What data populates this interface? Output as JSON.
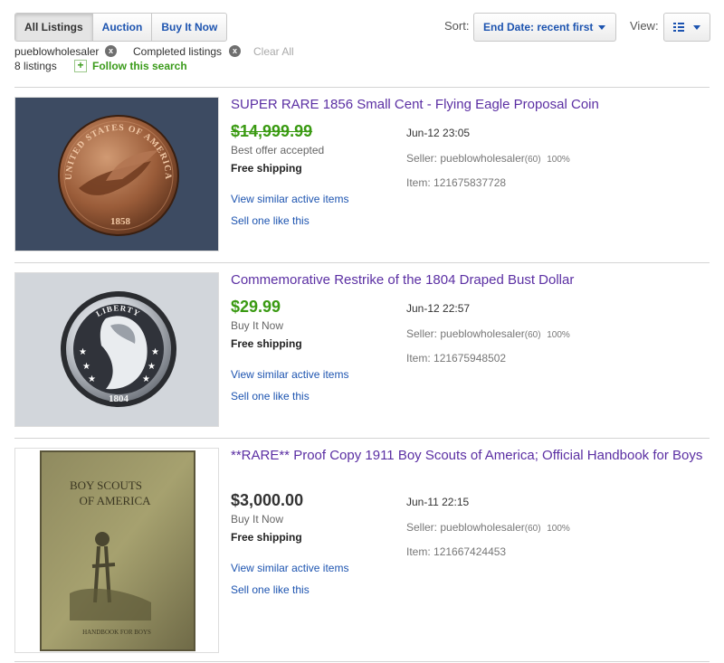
{
  "tabs": [
    "All Listings",
    "Auction",
    "Buy It Now"
  ],
  "sort": {
    "label": "Sort:",
    "value": "End Date: recent first"
  },
  "view": {
    "label": "View:"
  },
  "filters": [
    {
      "label": "pueblowholesaler",
      "remove_icon": "x"
    },
    {
      "label": "Completed listings",
      "remove_icon": "x"
    }
  ],
  "clear_all": "Clear All",
  "listing_count": "8 listings",
  "follow_label": "Follow this search",
  "listings": [
    {
      "title": "SUPER RARE 1856 Small Cent - Flying Eagle Proposal Coin",
      "price": "$14,999.99",
      "status": "Best offer accepted",
      "shipping": "Free shipping",
      "link_similar": "View similar active items",
      "link_sell": "Sell one like this",
      "date": "Jun-12 23:05",
      "seller_label": "Seller:",
      "seller_name": "pueblowholesaler",
      "seller_score": "(60)",
      "seller_pct": "100%",
      "item_label": "Item:",
      "item_number": "121675837728"
    },
    {
      "title": "Commemorative Restrike of the 1804 Draped Bust Dollar",
      "price": "$29.99",
      "status": "Buy It Now",
      "shipping": "Free shipping",
      "link_similar": "View similar active items",
      "link_sell": "Sell one like this",
      "date": "Jun-12 22:57",
      "seller_label": "Seller:",
      "seller_name": "pueblowholesaler",
      "seller_score": "(60)",
      "seller_pct": "100%",
      "item_label": "Item:",
      "item_number": "121675948502"
    },
    {
      "title": "**RARE** Proof Copy 1911 Boy Scouts of America; Official Handbook for Boys",
      "price": "$3,000.00",
      "status": "Buy It Now",
      "shipping": "Free shipping",
      "link_similar": "View similar active items",
      "link_sell": "Sell one like this",
      "date": "Jun-11 22:15",
      "seller_label": "Seller:",
      "seller_name": "pueblowholesaler",
      "seller_score": "(60)",
      "seller_pct": "100%",
      "item_label": "Item:",
      "item_number": "121667424453"
    }
  ],
  "images": {
    "coin1_top": "UNITED STATES OF AMERICA",
    "coin1_date": "1858",
    "coin2_top": "LIBERTY",
    "coin2_date": "1804",
    "book_title_1": "BOY SCOUTS",
    "book_title_2": "OF AMERICA",
    "book_footer": "HANDBOOK FOR BOYS"
  },
  "colors": {
    "link": "#1d54b0",
    "title": "#5b2fa3",
    "price_green": "#3a9a12",
    "follow_green": "#3b9b1b"
  }
}
